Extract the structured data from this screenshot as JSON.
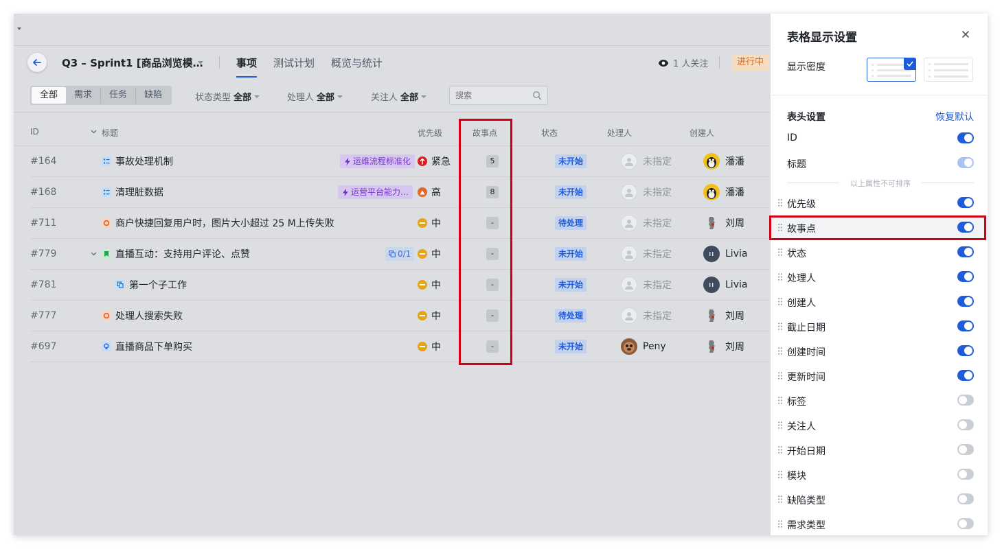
{
  "header": {
    "sprint_title": "Q3 – Sprint1 [商品浏览模…",
    "tabs": [
      {
        "label": "事项",
        "active": true
      },
      {
        "label": "测试计划",
        "active": false
      },
      {
        "label": "概览与统计",
        "active": false
      }
    ],
    "followers": "1 人关注",
    "status": "进行中"
  },
  "filters": {
    "segments": [
      "全部",
      "需求",
      "任务",
      "缺陷"
    ],
    "active_segment": "全部",
    "status_type": {
      "label": "状态类型",
      "value": "全部"
    },
    "assignee": {
      "label": "处理人",
      "value": "全部"
    },
    "follower": {
      "label": "关注人",
      "value": "全部"
    },
    "search_placeholder": "搜索"
  },
  "table": {
    "columns": [
      "ID",
      "标题",
      "优先级",
      "故事点",
      "状态",
      "处理人",
      "创建人"
    ],
    "rows": [
      {
        "id": "#164",
        "type": "task",
        "title": "事故处理机制",
        "tag": "运维流程标准化",
        "priority": "紧急",
        "priority_color": "#d81e1e",
        "points": "5",
        "status": "未开始",
        "assignee": "未指定",
        "creator": "潘潘",
        "creator_avatar": "penguin"
      },
      {
        "id": "#168",
        "type": "task",
        "title": "清理脏数据",
        "tag": "运营平台能力…",
        "priority": "高",
        "priority_color": "#e2692b",
        "points": "8",
        "status": "未开始",
        "assignee": "未指定",
        "creator": "潘潘",
        "creator_avatar": "penguin"
      },
      {
        "id": "#711",
        "type": "bug",
        "title": "商户快捷回复用户时，图片大小超过 25 M上传失败",
        "tag": "",
        "priority": "中",
        "priority_color": "#e6a418",
        "points": "-",
        "status": "待处理",
        "assignee": "未指定",
        "creator": "刘周",
        "creator_avatar": "statue"
      },
      {
        "id": "#779",
        "type": "story",
        "title": "直播互动：支持用户评论、点赞",
        "subtask": "0/1",
        "tag": "",
        "priority": "中",
        "priority_color": "#e6a418",
        "points": "-",
        "status": "未开始",
        "assignee": "未指定",
        "creator": "Livia",
        "creator_avatar": "livia"
      },
      {
        "id": "#781",
        "type": "subtask",
        "title": "第一个子工作",
        "tag": "",
        "priority": "中",
        "priority_color": "#e6a418",
        "points": "-",
        "status": "未开始",
        "assignee": "未指定",
        "creator": "Livia",
        "creator_avatar": "livia"
      },
      {
        "id": "#777",
        "type": "bug",
        "title": "处理人搜索失败",
        "tag": "",
        "priority": "中",
        "priority_color": "#e6a418",
        "points": "-",
        "status": "待处理",
        "assignee": "未指定",
        "creator": "刘周",
        "creator_avatar": "statue"
      },
      {
        "id": "#697",
        "type": "idea",
        "title": "直播商品下单购买",
        "tag": "",
        "priority": "中",
        "priority_color": "#e6a418",
        "points": "-",
        "status": "未开始",
        "assignee": "Peny",
        "creator": "刘周",
        "creator_avatar": "statue"
      }
    ]
  },
  "panel": {
    "title": "表格显示设置",
    "density_label": "显示密度",
    "header_settings": "表头设置",
    "restore_default": "恢复默认",
    "divider_text": "以上属性不可排序",
    "fixed_fields": [
      {
        "label": "ID",
        "state": "on"
      },
      {
        "label": "标题",
        "state": "disabled"
      }
    ],
    "fields": [
      {
        "label": "优先级",
        "state": "on"
      },
      {
        "label": "故事点",
        "state": "on"
      },
      {
        "label": "状态",
        "state": "on"
      },
      {
        "label": "处理人",
        "state": "on"
      },
      {
        "label": "创建人",
        "state": "on"
      },
      {
        "label": "截止日期",
        "state": "on"
      },
      {
        "label": "创建时间",
        "state": "on"
      },
      {
        "label": "更新时间",
        "state": "on"
      },
      {
        "label": "标签",
        "state": "off"
      },
      {
        "label": "关注人",
        "state": "off"
      },
      {
        "label": "开始日期",
        "state": "off"
      },
      {
        "label": "模块",
        "state": "off"
      },
      {
        "label": "缺陷类型",
        "state": "off"
      },
      {
        "label": "需求类型",
        "state": "off"
      }
    ]
  },
  "colors": {
    "accent": "#1e5cdb",
    "highlight": "#d10015"
  }
}
